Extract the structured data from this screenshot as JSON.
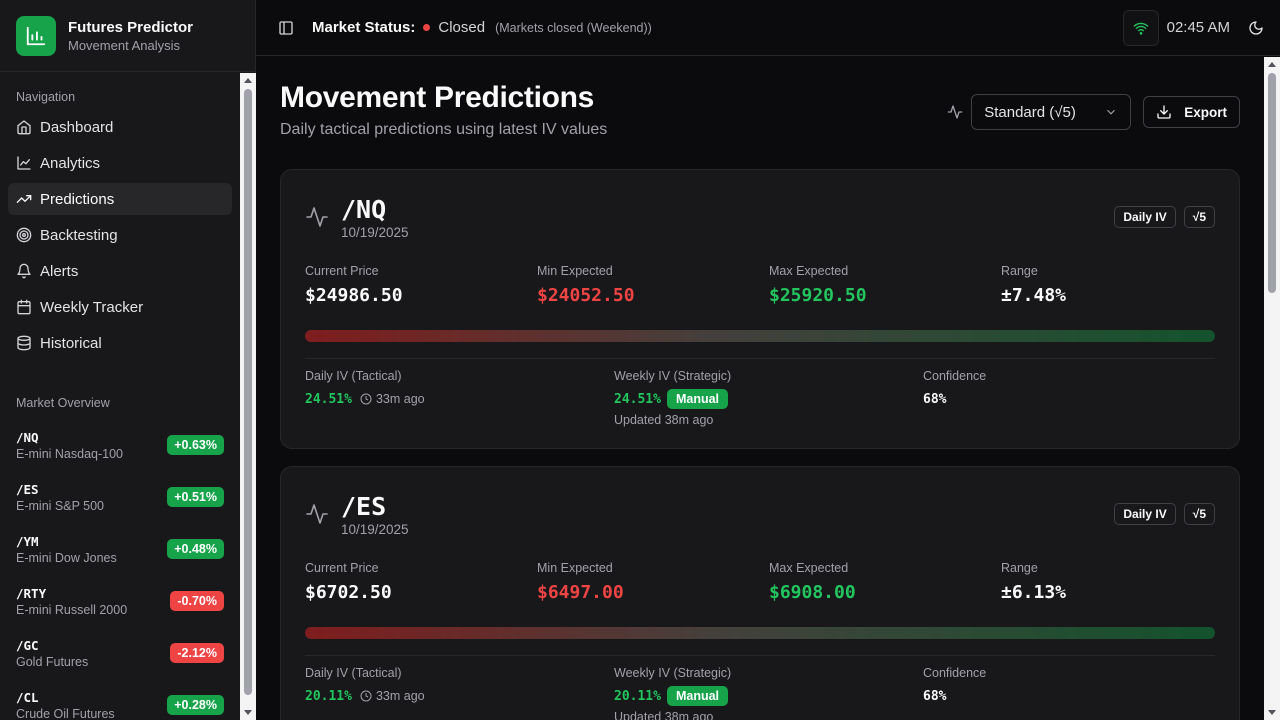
{
  "app": {
    "title": "Futures Predictor",
    "subtitle": "Movement Analysis"
  },
  "sidebar": {
    "nav_label": "Navigation",
    "items": [
      {
        "label": "Dashboard",
        "icon": "home-icon"
      },
      {
        "label": "Analytics",
        "icon": "chart-line-icon"
      },
      {
        "label": "Predictions",
        "icon": "trending-up-icon",
        "active": true
      },
      {
        "label": "Backtesting",
        "icon": "target-icon"
      },
      {
        "label": "Alerts",
        "icon": "bell-icon"
      },
      {
        "label": "Weekly Tracker",
        "icon": "calendar-icon"
      },
      {
        "label": "Historical",
        "icon": "database-icon"
      }
    ],
    "market_label": "Market Overview",
    "markets": [
      {
        "symbol": "/NQ",
        "name": "E-mini Nasdaq-100",
        "change": "+0.63%",
        "color": "#16a34a"
      },
      {
        "symbol": "/ES",
        "name": "E-mini S&P 500",
        "change": "+0.51%",
        "color": "#16a34a"
      },
      {
        "symbol": "/YM",
        "name": "E-mini Dow Jones",
        "change": "+0.48%",
        "color": "#16a34a"
      },
      {
        "symbol": "/RTY",
        "name": "E-mini Russell 2000",
        "change": "-0.70%",
        "color": "#ef4444"
      },
      {
        "symbol": "/GC",
        "name": "Gold Futures",
        "change": "-2.12%",
        "color": "#ef4444"
      },
      {
        "symbol": "/CL",
        "name": "Crude Oil Futures",
        "change": "+0.28%",
        "color": "#16a34a"
      }
    ]
  },
  "topbar": {
    "market_label": "Market Status:",
    "status": "Closed",
    "note": "(Markets closed (Weekend))",
    "time": "02:45 AM"
  },
  "page": {
    "title": "Movement Predictions",
    "subtitle": "Daily tactical predictions using latest IV values",
    "select_value": "Standard (√5)",
    "export_label": "Export"
  },
  "cards": [
    {
      "symbol": "/NQ",
      "date": "10/19/2025",
      "badge1": "Daily IV",
      "badge2": "√5",
      "current_label": "Current Price",
      "current": "$24986.50",
      "min_label": "Min Expected",
      "min": "$24052.50",
      "max_label": "Max Expected",
      "max": "$25920.50",
      "range_label": "Range",
      "range": "±7.48%",
      "daily_label": "Daily IV (Tactical)",
      "daily_iv": "24.51%",
      "daily_ago": "33m ago",
      "weekly_label": "Weekly IV (Strategic)",
      "weekly_iv": "24.51%",
      "manual": "Manual",
      "updated": "Updated 38m ago",
      "conf_label": "Confidence",
      "confidence": "68%"
    },
    {
      "symbol": "/ES",
      "date": "10/19/2025",
      "badge1": "Daily IV",
      "badge2": "√5",
      "current_label": "Current Price",
      "current": "$6702.50",
      "min_label": "Min Expected",
      "min": "$6497.00",
      "max_label": "Max Expected",
      "max": "$6908.00",
      "range_label": "Range",
      "range": "±6.13%",
      "daily_label": "Daily IV (Tactical)",
      "daily_iv": "20.11%",
      "daily_ago": "33m ago",
      "weekly_label": "Weekly IV (Strategic)",
      "weekly_iv": "20.11%",
      "manual": "Manual",
      "updated": "Updated 38m ago",
      "conf_label": "Confidence",
      "confidence": "68%"
    }
  ],
  "colors": {
    "accent": "#16a34a",
    "down": "#ef4444",
    "up": "#22c55e"
  }
}
